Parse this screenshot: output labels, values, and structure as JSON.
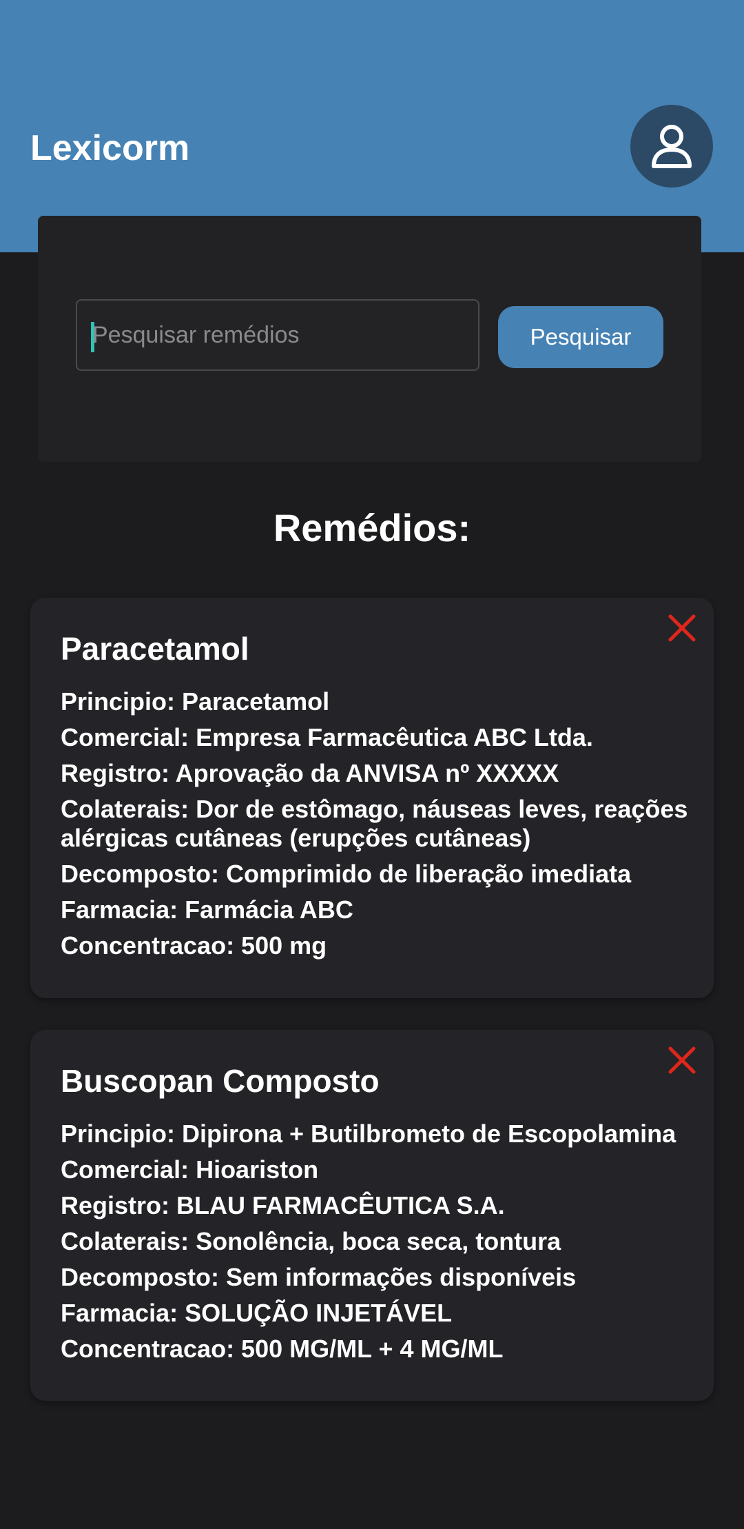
{
  "header": {
    "title": "Lexicorm",
    "avatar_icon": "user-icon",
    "background": "#4682b4"
  },
  "search": {
    "placeholder": "Pesquisar remédios",
    "button_label": "Pesquisar"
  },
  "list": {
    "title": "Remédios:",
    "items": [
      {
        "name": "Paracetamol",
        "fields": [
          "Principio: Paracetamol",
          "Comercial: Empresa Farmacêutica ABC Ltda.",
          "Registro: Aprovação da ANVISA nº XXXXX",
          "Colaterais: Dor de estômago, náuseas leves, reações alérgicas cutâneas (erupções cutâneas)",
          "Decomposto: Comprimido de liberação imediata",
          "Farmacia: Farmácia ABC",
          "Concentracao: 500 mg"
        ]
      },
      {
        "name": "Buscopan Composto",
        "fields": [
          "Principio: Dipirona + Butilbrometo de Escopolamina",
          "Comercial: Hioariston",
          "Registro: BLAU FARMACÊUTICA S.A.",
          "Colaterais: Sonolência, boca seca, tontura",
          "Decomposto: Sem informações disponíveis",
          "Farmacia: SOLUÇÃO INJETÁVEL",
          "Concentracao: 500 MG/ML + 4 MG/ML"
        ]
      }
    ]
  },
  "colors": {
    "accent": "#4682b4",
    "delete": "#e0261b",
    "background": "#1c1c1e"
  }
}
